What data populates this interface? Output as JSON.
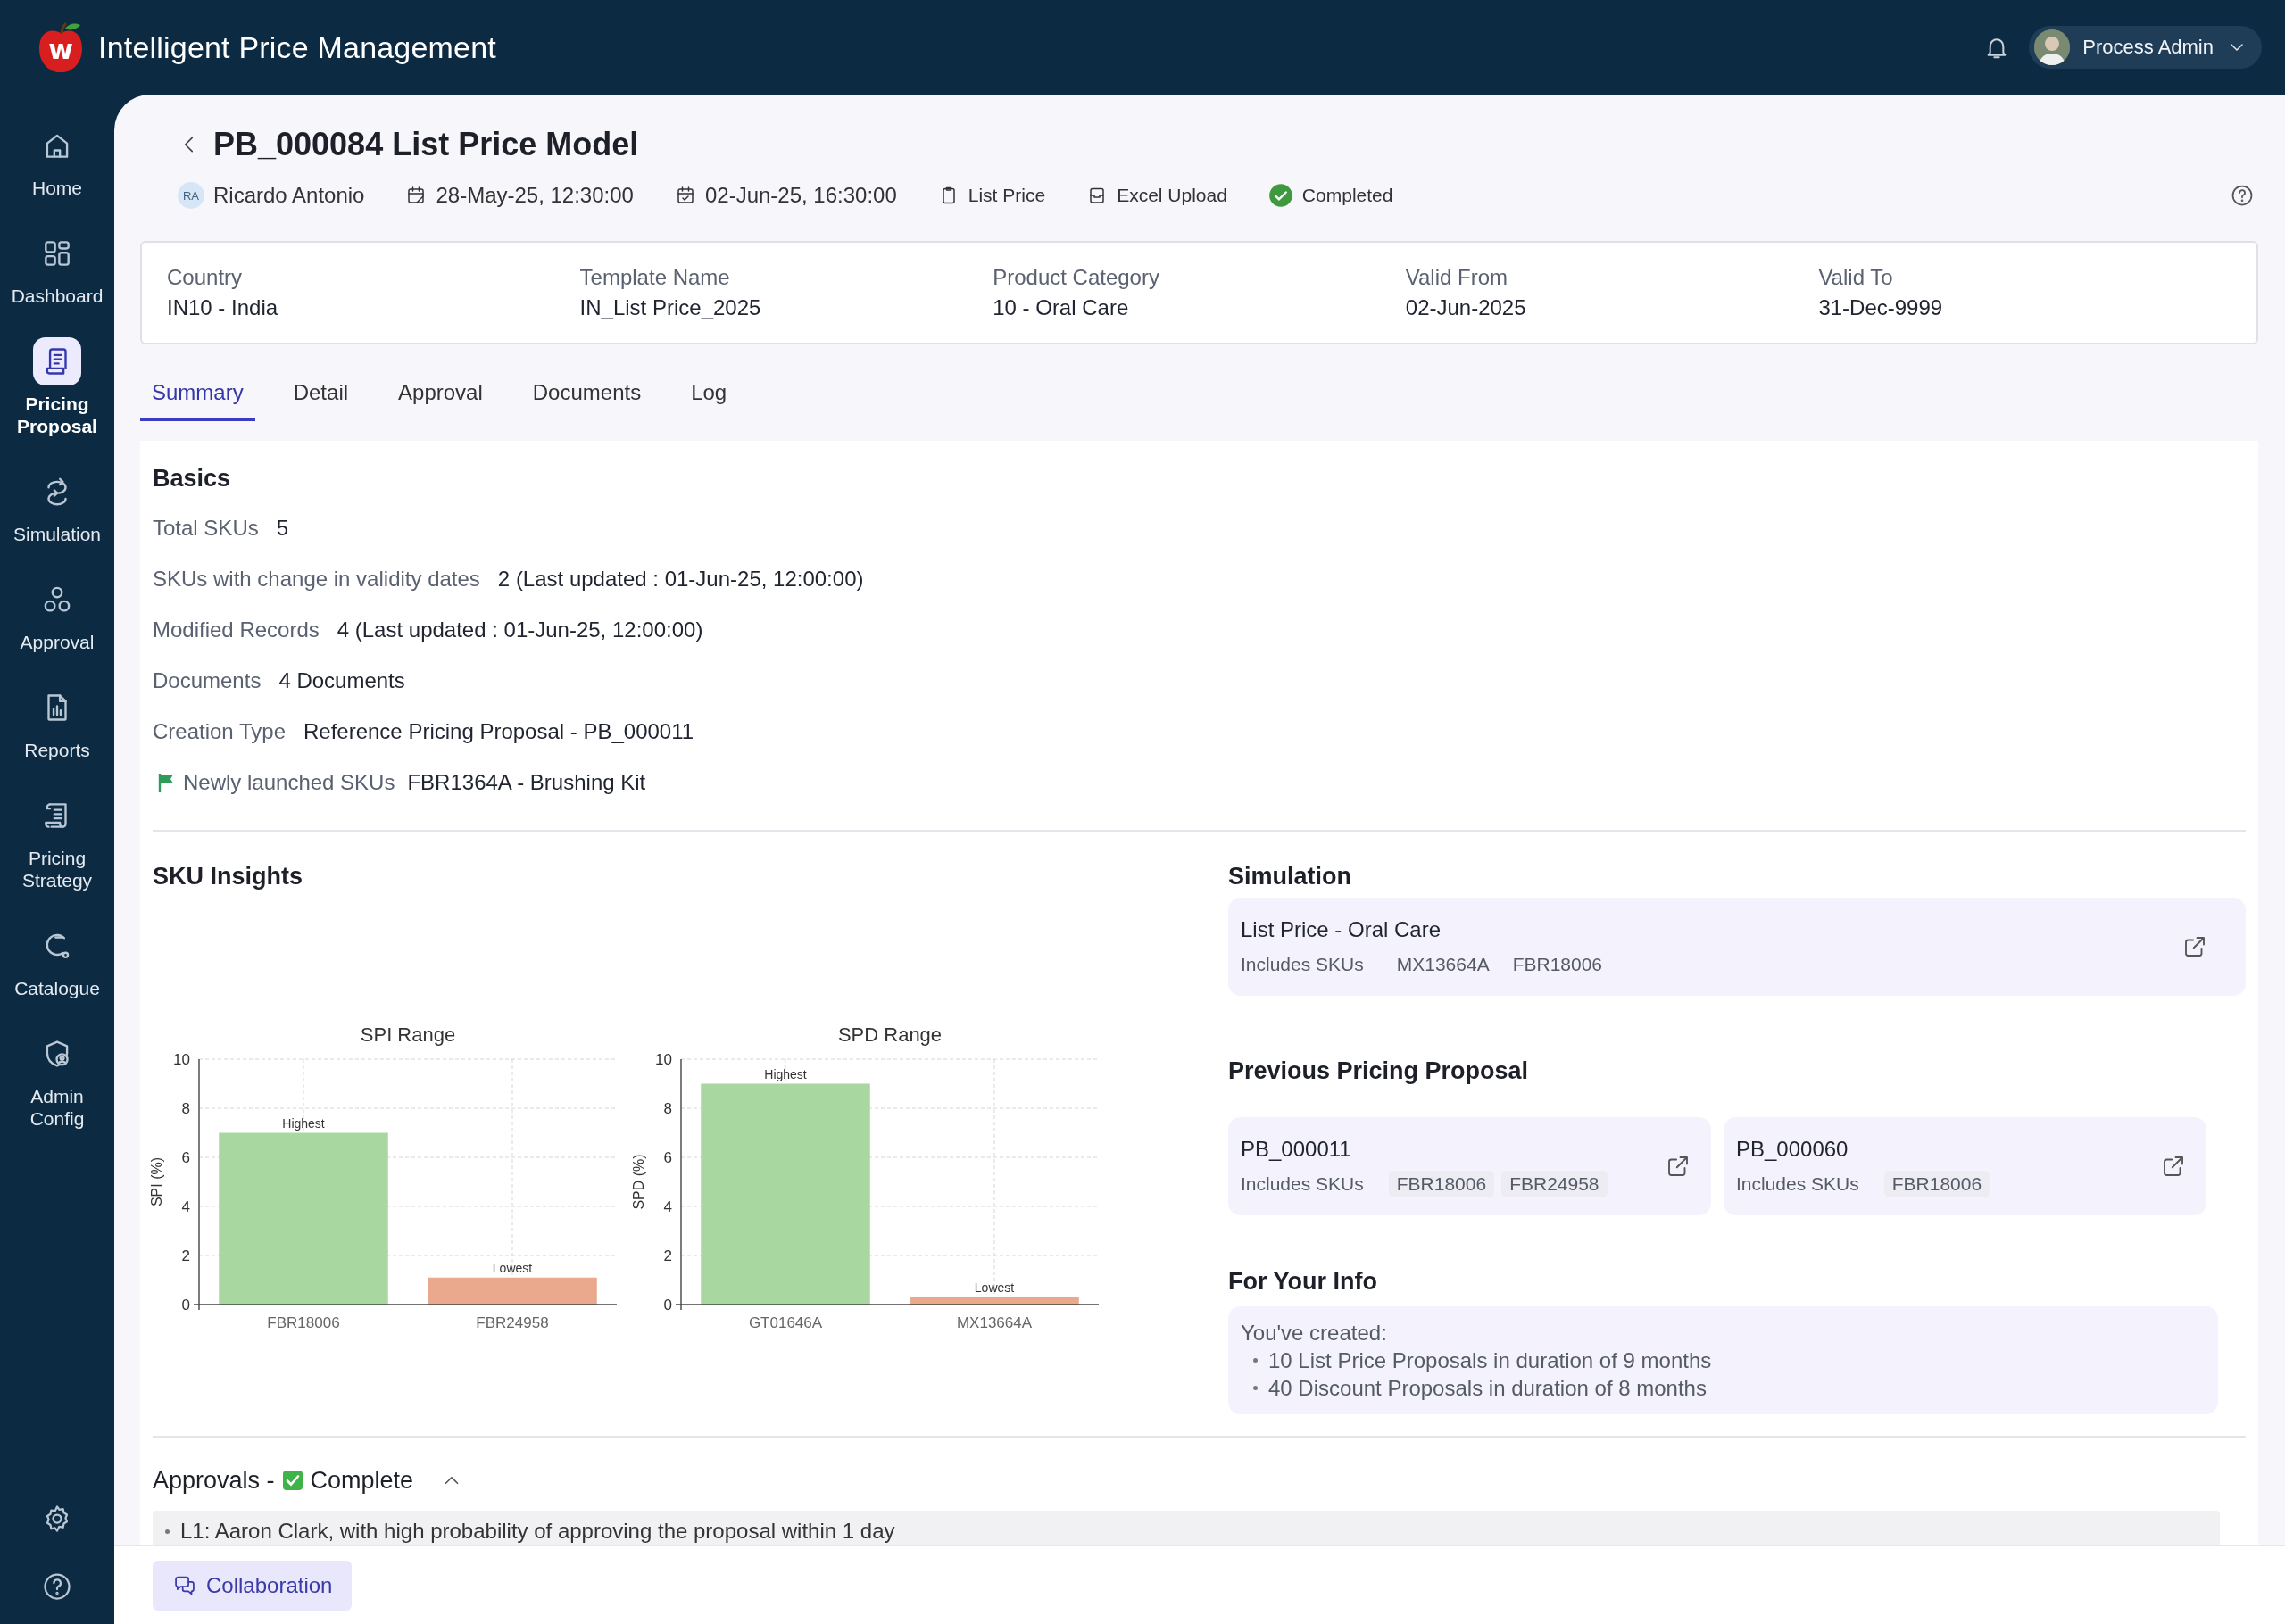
{
  "app": {
    "logo_letter": "w",
    "title": "Intelligent Price Management"
  },
  "user": {
    "name": "Process Admin"
  },
  "sidebar": {
    "items": [
      {
        "label": "Home",
        "selected": false
      },
      {
        "label": "Dashboard",
        "selected": false
      },
      {
        "label": "Pricing Proposal",
        "selected": true
      },
      {
        "label": "Simulation",
        "selected": false
      },
      {
        "label": "Approval",
        "selected": false
      },
      {
        "label": "Reports",
        "selected": false
      },
      {
        "label": "Pricing Strategy",
        "selected": false
      },
      {
        "label": "Catalogue",
        "selected": false
      },
      {
        "label": "Admin Config",
        "selected": false
      }
    ]
  },
  "proposal": {
    "title": "PB_000084 List Price Model",
    "owner_initials": "RA",
    "owner": "Ricardo Antonio",
    "created": "28-May-25, 12:30:00",
    "updated": "02-Jun-25, 16:30:00",
    "price_type": "List Price",
    "source": "Excel Upload",
    "status": "Completed"
  },
  "fields": [
    {
      "label": "Country",
      "value": "IN10 - India"
    },
    {
      "label": "Template Name",
      "value": "IN_List Price_2025"
    },
    {
      "label": "Product Category",
      "value": "10 - Oral Care"
    },
    {
      "label": "Valid From",
      "value": "02-Jun-2025"
    },
    {
      "label": "Valid To",
      "value": "31-Dec-9999"
    }
  ],
  "tabs": [
    {
      "label": "Summary",
      "selected": true
    },
    {
      "label": "Detail",
      "selected": false
    },
    {
      "label": "Approval",
      "selected": false
    },
    {
      "label": "Documents",
      "selected": false
    },
    {
      "label": "Log",
      "selected": false
    }
  ],
  "basics": {
    "title": "Basics",
    "rows": [
      {
        "kind": "plain",
        "label": "Total SKUs",
        "value": "5"
      },
      {
        "kind": "plain",
        "label": "SKUs with change in validity dates",
        "value": "2 (Last updated : 01-Jun-25, 12:00:00)"
      },
      {
        "kind": "plain",
        "label": "Modified Records",
        "value": "4 (Last updated : 01-Jun-25, 12:00:00)"
      },
      {
        "kind": "plain",
        "label": "Documents",
        "value": "4 Documents"
      },
      {
        "kind": "plain",
        "label": "Creation Type",
        "value": "Reference Pricing Proposal - PB_000011"
      },
      {
        "kind": "flagged",
        "label": "Newly launched SKUs",
        "value": "FBR1364A - Brushing Kit"
      }
    ]
  },
  "sku_insights": {
    "title": "SKU Insights",
    "charts": [
      {
        "chart_data": {
          "type": "bar",
          "grid": true,
          "title": "SPI Range",
          "ylabel": "SPI (%)",
          "categories": [
            "FBR18006",
            "FBR24958"
          ],
          "ylim": [
            0,
            10
          ],
          "yticks": [
            0,
            2,
            4,
            6,
            8,
            10
          ],
          "series": [
            {
              "name": "Highest",
              "color": "#a8d8a0",
              "values": [
                7,
                null
              ]
            },
            {
              "name": "Lowest",
              "color": "#eaa98c",
              "values": [
                null,
                1.1
              ]
            }
          ]
        }
      },
      {
        "chart_data": {
          "type": "bar",
          "grid": true,
          "title": "SPD Range",
          "ylabel": "SPD (%)",
          "categories": [
            "GT01646A",
            "MX13664A"
          ],
          "ylim": [
            0,
            10
          ],
          "yticks": [
            0,
            2,
            4,
            6,
            8,
            10
          ],
          "series": [
            {
              "name": "Highest",
              "color": "#a8d8a0",
              "values": [
                9,
                null
              ]
            },
            {
              "name": "Lowest",
              "color": "#eaa98c",
              "values": [
                null,
                0.3
              ]
            }
          ]
        }
      }
    ]
  },
  "simulation": {
    "title": "Simulation",
    "cards": [
      {
        "name": "List Price - Oral Care",
        "skus_label": "Includes SKUs",
        "skus": [
          "MX13664A",
          "FBR18006"
        ]
      }
    ]
  },
  "previous_proposals": {
    "title": "Previous Pricing Proposal",
    "cards": [
      {
        "name": "PB_000011",
        "skus_label": "Includes SKUs",
        "skus": [
          "FBR18006",
          "FBR24958"
        ]
      },
      {
        "name": "PB_000060",
        "skus_label": "Includes SKUs",
        "skus": [
          "FBR18006"
        ]
      }
    ]
  },
  "info": {
    "title": "For Your Info",
    "intro": "You've created:",
    "items": [
      "10 List Price Proposals in duration of 9 months",
      "40 Discount Proposals in duration of 8 months"
    ]
  },
  "approvals": {
    "title": "Approvals -",
    "status": "Complete",
    "complete": true,
    "expanded": true,
    "items": [
      "L1: Aaron Clark, with high probability of approving the proposal within 1 day"
    ]
  },
  "collaboration": {
    "label": "Collaboration"
  }
}
